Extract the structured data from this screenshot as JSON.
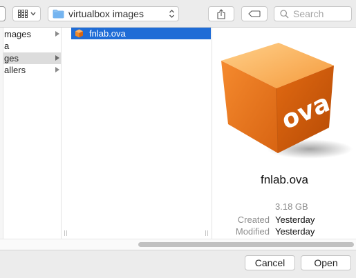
{
  "toolbar": {
    "path_label": "virtualbox images",
    "search_placeholder": "Search"
  },
  "sidebar_column": {
    "items": [
      {
        "label": "mages",
        "has_children": true,
        "selected": false
      },
      {
        "label": "a",
        "has_children": false,
        "selected": false
      },
      {
        "label": "ges",
        "has_children": true,
        "selected": true
      },
      {
        "label": "allers",
        "has_children": true,
        "selected": false
      }
    ]
  },
  "file_column": {
    "selected_file": "fnlab.ova"
  },
  "preview": {
    "icon_text": "ova",
    "file_name": "fnlab.ova",
    "size": "3.18 GB",
    "created_label": "Created",
    "created_value": "Yesterday",
    "modified_label": "Modified",
    "modified_value": "Yesterday"
  },
  "buttons": {
    "cancel_label": "Cancel",
    "open_label": "Open"
  },
  "colors": {
    "selection": "#1f6cd6",
    "cube_orange": "#f07a1e"
  }
}
